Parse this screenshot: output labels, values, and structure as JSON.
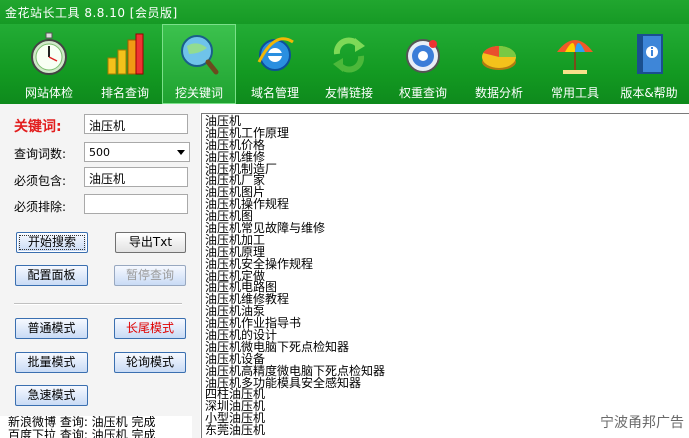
{
  "window": {
    "title": "金花站长工具 8.8.10 [会员版]"
  },
  "toolbar": {
    "items": [
      {
        "label": "网站体检",
        "icon": "stopwatch-icon"
      },
      {
        "label": "排名查询",
        "icon": "bar-chart-icon"
      },
      {
        "label": "挖关键词",
        "icon": "magnifier-globe-icon"
      },
      {
        "label": "域名管理",
        "icon": "ie-globe-icon"
      },
      {
        "label": "友情链接",
        "icon": "refresh-arrows-icon"
      },
      {
        "label": "权重查询",
        "icon": "tachometer-icon"
      },
      {
        "label": "数据分析",
        "icon": "pie-chart-icon"
      },
      {
        "label": "常用工具",
        "icon": "umbrella-icon"
      },
      {
        "label": "版本&帮助",
        "icon": "info-book-icon"
      }
    ],
    "active_index": 2
  },
  "form": {
    "keyword_label": "关键词:",
    "keyword_value": "油压机",
    "count_label": "查询词数:",
    "count_value": "500",
    "include_label": "必须包含:",
    "include_value": "油压机",
    "exclude_label": "必须排除:",
    "exclude_value": ""
  },
  "buttons": {
    "start": "开始搜索",
    "export": "导出Txt",
    "config": "配置面板",
    "pause": "暂停查询",
    "normal_mode": "普通模式",
    "longtail_mode": "长尾模式",
    "batch_mode": "批量模式",
    "poll_mode": "轮询模式",
    "fast_mode": "急速模式"
  },
  "status": {
    "lines": [
      "新浪微博 查询: 油压机 完成",
      "百度下拉 查询: 油压机 完成"
    ]
  },
  "results": [
    "油压机",
    "油压机工作原理",
    "油压机价格",
    "油压机维修",
    "油压机制造厂",
    "油压机厂家",
    "油压机图片",
    "油压机操作规程",
    "油压机图",
    "油压机常见故障与维修",
    "油压机加工",
    "油压机原理",
    "油压机安全操作规程",
    "油压机定做",
    "油压机电路图",
    "油压机维修教程",
    "油压机油泵",
    "油压机作业指导书",
    "油压机的设计",
    "油压机微电脑下死点检知器",
    "油压机设备",
    "油压机高精度微电脑下死点检知器",
    "油压机多功能模具安全感知器",
    "四柱油压机",
    "深圳油压机",
    "小型油压机",
    "东莞油压机"
  ],
  "ad_text": "宁波甬邦广告",
  "colors": {
    "toolbar_green": "#169a25",
    "keyword_red": "#e21d1d",
    "button_blue": "#3a6fb0"
  }
}
